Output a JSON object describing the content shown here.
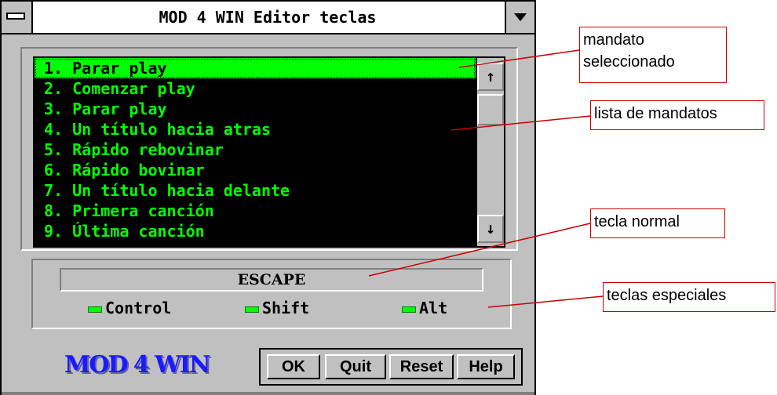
{
  "window": {
    "title": "MOD 4 WIN Editor teclas"
  },
  "commands": [
    "1. Parar play",
    "2. Comenzar play",
    "3. Parar play",
    "4. Un título hacia atras",
    "5. Rápido rebovinar",
    "6. Rápido bovinar",
    "7. Un título hacia delante",
    "8. Primera canción",
    "9. Última canción"
  ],
  "selected_index": 0,
  "scroll": {
    "up_icon": "↑",
    "down_icon": "↓"
  },
  "key_field": {
    "value": "ESCAPE"
  },
  "modifiers": {
    "control": "Control",
    "shift": "Shift",
    "alt": "Alt"
  },
  "logo": "MOD 4 WIN",
  "buttons": {
    "ok": "OK",
    "quit": "Quit",
    "reset": "Reset",
    "help": "Help"
  },
  "callouts": {
    "selected_line1": "mandato",
    "selected_line2": "seleccionado",
    "list": "lista de mandatos",
    "normal_key": "tecla normal",
    "special_keys": "teclas especiales"
  },
  "colors": {
    "list_text": "#00ff00",
    "list_bg": "#000000",
    "window_bg": "#c0c0c0",
    "callout_border": "#cc0000",
    "logo": "#1a1aff"
  }
}
